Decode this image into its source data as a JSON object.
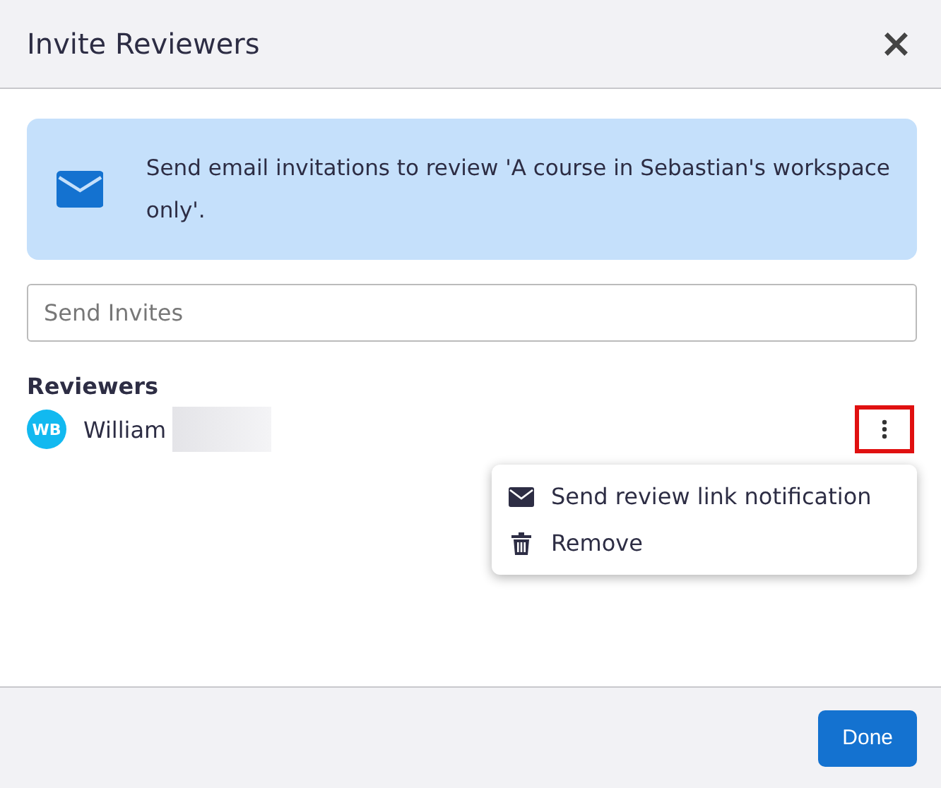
{
  "dialog": {
    "title": "Invite Reviewers",
    "close_label": "×"
  },
  "notice": {
    "text": "Send email invitations to review 'A course in Sebastian's workspace only'."
  },
  "invite_field": {
    "placeholder": "Send Invites"
  },
  "reviewers": {
    "heading": "Reviewers",
    "items": [
      {
        "initials": "WB",
        "name": "William",
        "name_redacted": true,
        "menu_highlighted": true
      }
    ]
  },
  "context_menu": {
    "items": [
      {
        "kind": "mail",
        "label": "Send review link notification"
      },
      {
        "kind": "trash",
        "label": "Remove"
      }
    ]
  },
  "footer": {
    "buttons": [
      "Done"
    ]
  }
}
